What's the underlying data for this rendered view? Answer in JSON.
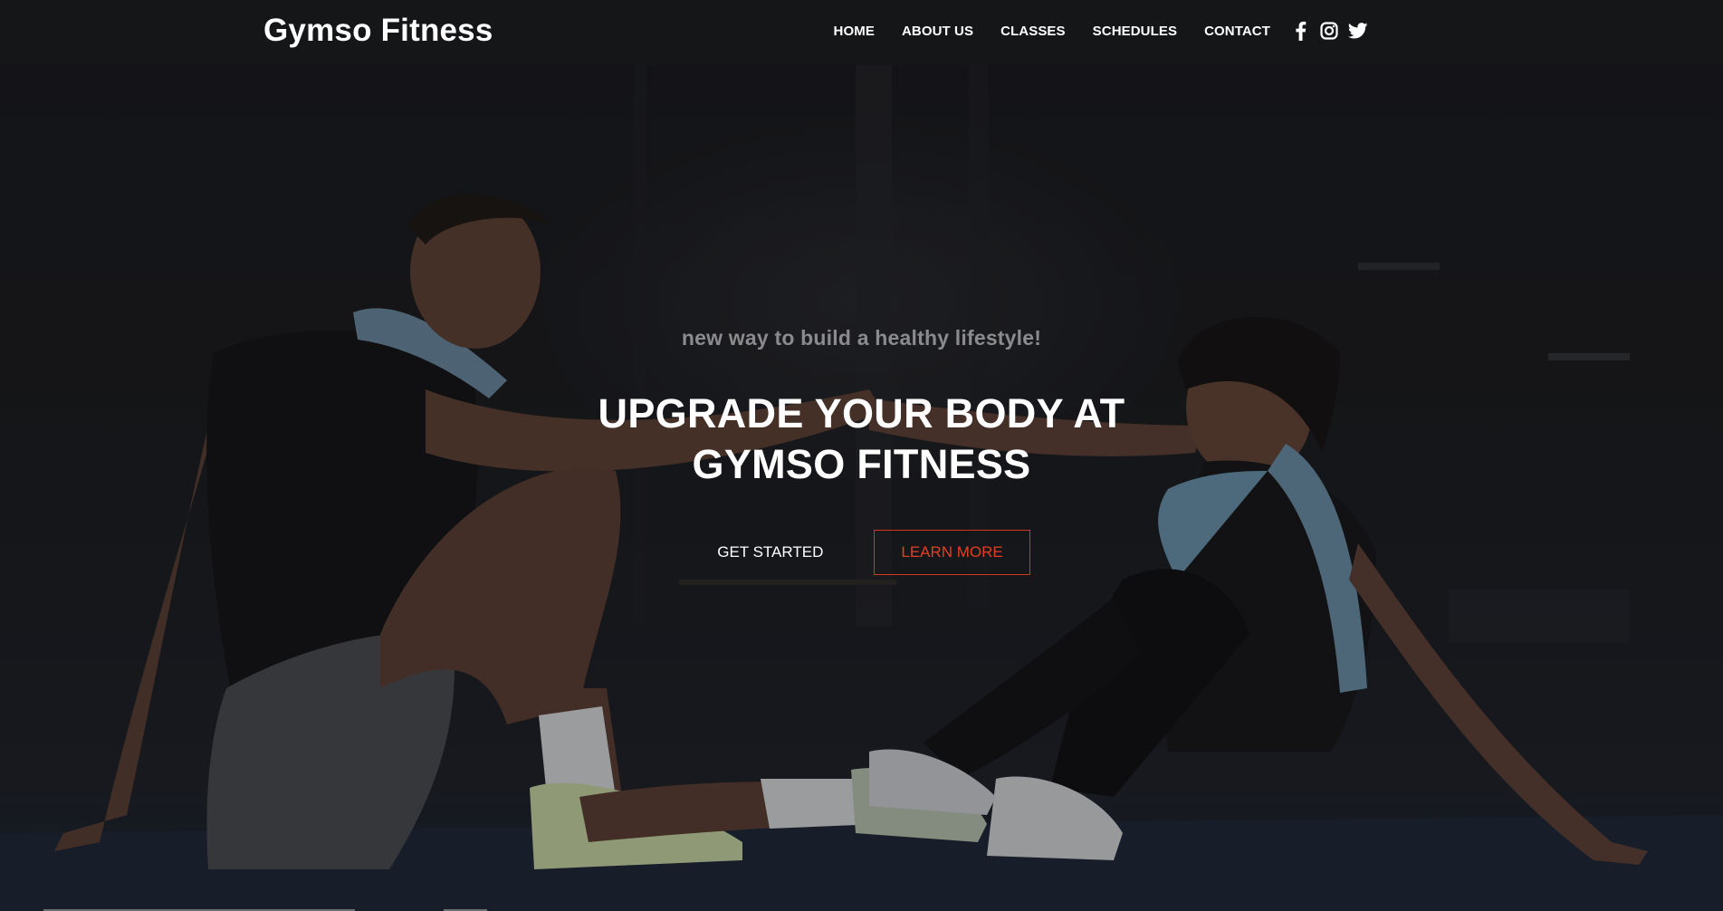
{
  "brand": {
    "name": "Gymso Fitness"
  },
  "nav": {
    "items": [
      {
        "label": "HOME"
      },
      {
        "label": "ABOUT US"
      },
      {
        "label": "CLASSES"
      },
      {
        "label": "SCHEDULES"
      },
      {
        "label": "CONTACT"
      }
    ],
    "social": [
      {
        "icon": "facebook-icon"
      },
      {
        "icon": "instagram-icon"
      },
      {
        "icon": "twitter-icon"
      }
    ]
  },
  "hero": {
    "tagline": "new way to build a healthy lifestyle!",
    "headline": "UPGRADE YOUR BODY AT GYMSO FITNESS",
    "primary_button": "GET STARTED",
    "secondary_button": "LEARN MORE"
  },
  "colors": {
    "accent": "#d4381a",
    "background": "#151618",
    "text": "#ffffff",
    "tagline": "#8b8b8e"
  }
}
